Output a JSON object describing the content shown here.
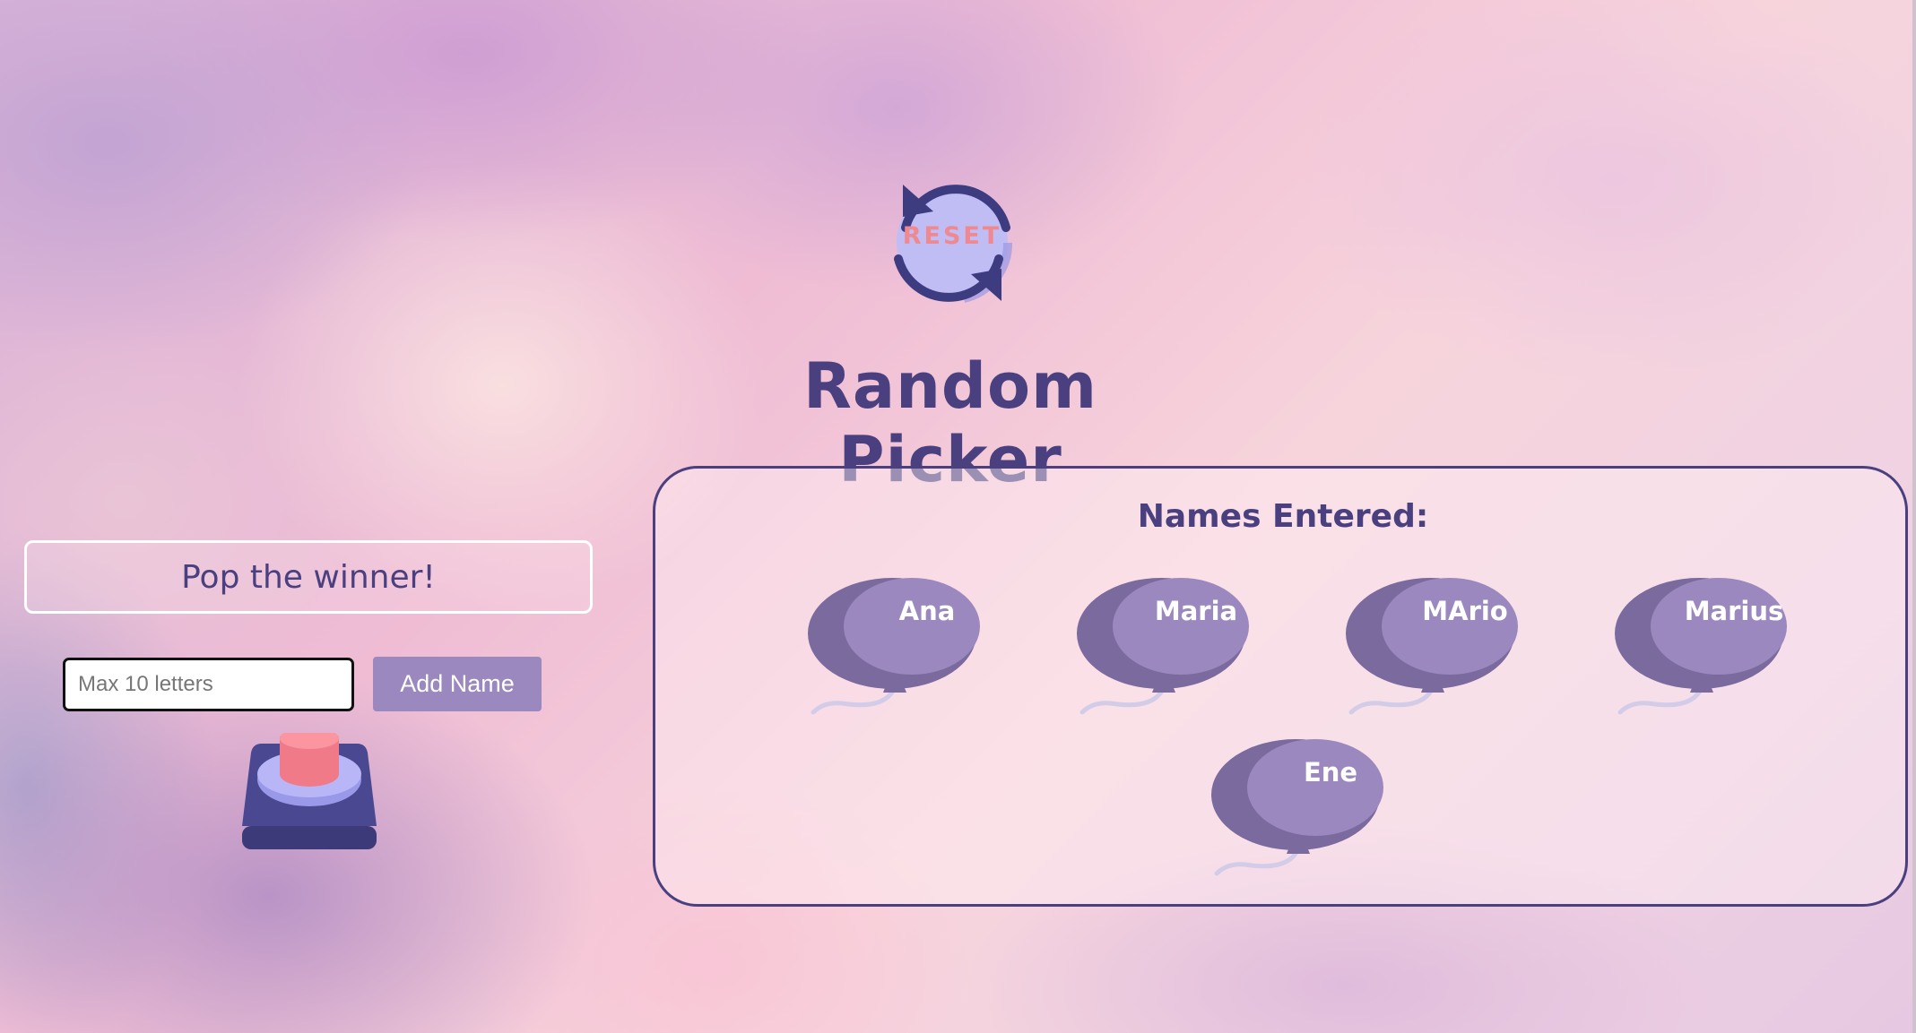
{
  "header": {
    "reset_label": "RESET",
    "title": "Random Picker"
  },
  "left_panel": {
    "winner_text": "Pop the winner!",
    "name_input": {
      "value": "",
      "placeholder": "Max 10 letters"
    },
    "add_button_label": "Add Name",
    "pop_button_icon": "big-push-button-icon"
  },
  "names_panel": {
    "heading": "Names Entered:",
    "balloons": [
      {
        "name": "Ana"
      },
      {
        "name": "Maria"
      },
      {
        "name": "MArio"
      },
      {
        "name": "Marius"
      },
      {
        "name": "Ene"
      }
    ]
  },
  "colors": {
    "primary": "#4a4080",
    "accent_pink": "#f08890",
    "balloon_light": "#9a88be",
    "balloon_dark": "#7a6a9e",
    "button": "#9a88be"
  }
}
